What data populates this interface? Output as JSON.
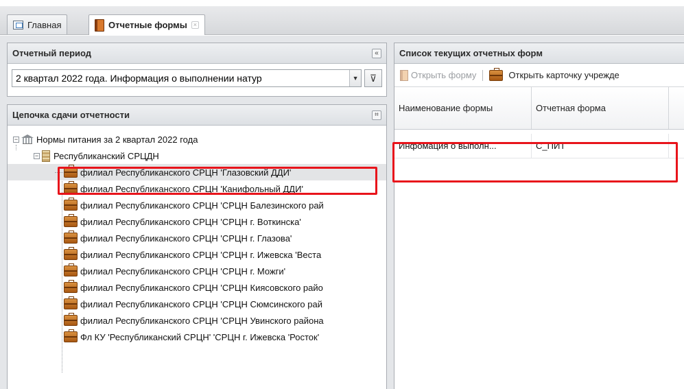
{
  "tabs": [
    {
      "label": "Главная",
      "active": false
    },
    {
      "label": "Отчетные формы",
      "active": true,
      "close": "×"
    }
  ],
  "period_panel": {
    "title": "Отчетный период",
    "collapse_glyph": "«",
    "selected_value": "2 квартал 2022 года. Информация о выполнении натур",
    "filter_glyph": "⊽"
  },
  "chain_panel": {
    "title": "Цепочка сдачи отчетности",
    "header_btn_glyph": "⌗",
    "root": {
      "label": "Нормы питания за 2 квартал 2022 года",
      "expander": "−"
    },
    "org": {
      "label": "Республиканский СРЦДН",
      "expander": "−"
    },
    "items": [
      "филиал Республиканского СРЦН 'Глазовский ДДИ'",
      "филиал Республиканского СРЦН 'Канифольный ДДИ'",
      "филиал Республиканского СРЦН 'СРЦН Балезинского рай",
      "филиал Республиканского СРЦН 'СРЦН г. Воткинска'",
      "филиал Республиканского СРЦН 'СРЦН г. Глазова'",
      "филиал Республиканского СРЦН 'СРЦН г. Ижевска 'Веста",
      "филиал Республиканского СРЦН 'СРЦН г. Можги'",
      "филиал Республиканского СРЦН 'СРЦН Киясовского райо",
      "филиал Республиканского СРЦН 'СРЦН Сюмсинского рай",
      "филиал Республиканского СРЦН 'СРЦН Увинского района",
      "Фл КУ 'Республиканский СРЦН' 'СРЦН г. Ижевска 'Росток'"
    ],
    "selected_index": 0
  },
  "list_panel": {
    "title": "Список текущих отчетных форм",
    "toolbar": {
      "open_form": "Открыть форму",
      "open_card": "Открыть карточку учрежде"
    },
    "columns": [
      "Наименование формы",
      "Отчетная форма"
    ],
    "rows": [
      [
        "Инфомация о выполн...",
        "С_ПИТ"
      ]
    ]
  },
  "colors": {
    "highlight": "#e8141b",
    "selected_row": "#e3e4e6"
  }
}
